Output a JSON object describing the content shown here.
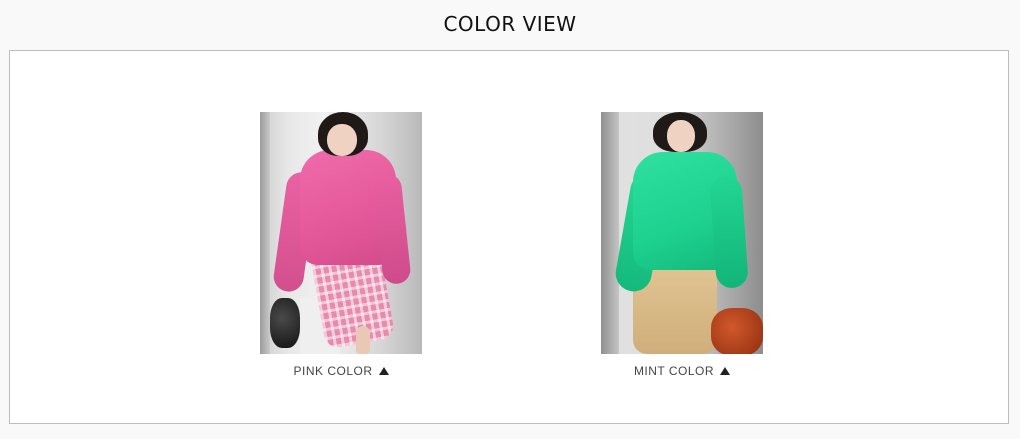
{
  "section": {
    "title": "COLOR VIEW"
  },
  "colors": [
    {
      "label": "PINK COLOR",
      "image_alt": "pink turtleneck sweater with pink check skirt",
      "icon": "triangle-up-icon",
      "swatch": "#e45899"
    },
    {
      "label": "MINT COLOR",
      "image_alt": "mint turtleneck sweater with beige skirt",
      "icon": "triangle-up-icon",
      "swatch": "#1ed18f"
    }
  ]
}
